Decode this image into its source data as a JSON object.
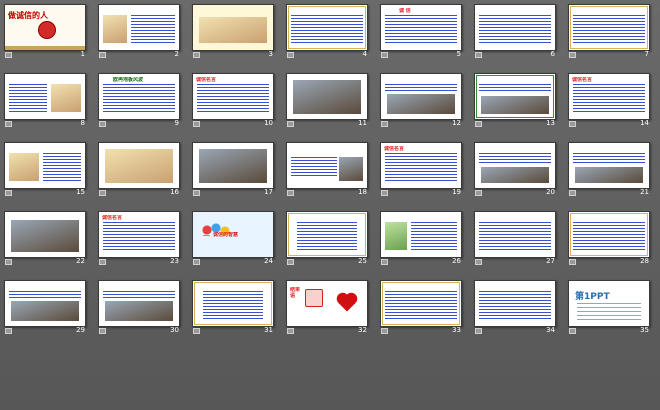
{
  "slides": [
    {
      "number": "1",
      "title": "做诚信的人"
    },
    {
      "number": "2",
      "title": ""
    },
    {
      "number": "3",
      "title": ""
    },
    {
      "number": "4",
      "title": ""
    },
    {
      "number": "5",
      "title": "诚 信"
    },
    {
      "number": "6",
      "title": ""
    },
    {
      "number": "7",
      "title": ""
    },
    {
      "number": "8",
      "title": ""
    },
    {
      "number": "9",
      "title": "欧冉地板风波"
    },
    {
      "number": "10",
      "title": "诚信名言"
    },
    {
      "number": "11",
      "title": ""
    },
    {
      "number": "12",
      "title": ""
    },
    {
      "number": "13",
      "title": ""
    },
    {
      "number": "14",
      "title": "诚信名言"
    },
    {
      "number": "15",
      "title": ""
    },
    {
      "number": "16",
      "title": ""
    },
    {
      "number": "17",
      "title": ""
    },
    {
      "number": "18",
      "title": ""
    },
    {
      "number": "19",
      "title": "诚信名言"
    },
    {
      "number": "20",
      "title": ""
    },
    {
      "number": "21",
      "title": ""
    },
    {
      "number": "22",
      "title": ""
    },
    {
      "number": "23",
      "title": "诚信名言"
    },
    {
      "number": "24",
      "title": "二、诚信的智慧"
    },
    {
      "number": "25",
      "title": ""
    },
    {
      "number": "26",
      "title": ""
    },
    {
      "number": "27",
      "title": ""
    },
    {
      "number": "28",
      "title": ""
    },
    {
      "number": "29",
      "title": ""
    },
    {
      "number": "30",
      "title": ""
    },
    {
      "number": "31",
      "title": ""
    },
    {
      "number": "32",
      "title": "结束语"
    },
    {
      "number": "33",
      "title": ""
    },
    {
      "number": "34",
      "title": ""
    },
    {
      "number": "35",
      "title": "第1PPT"
    }
  ]
}
